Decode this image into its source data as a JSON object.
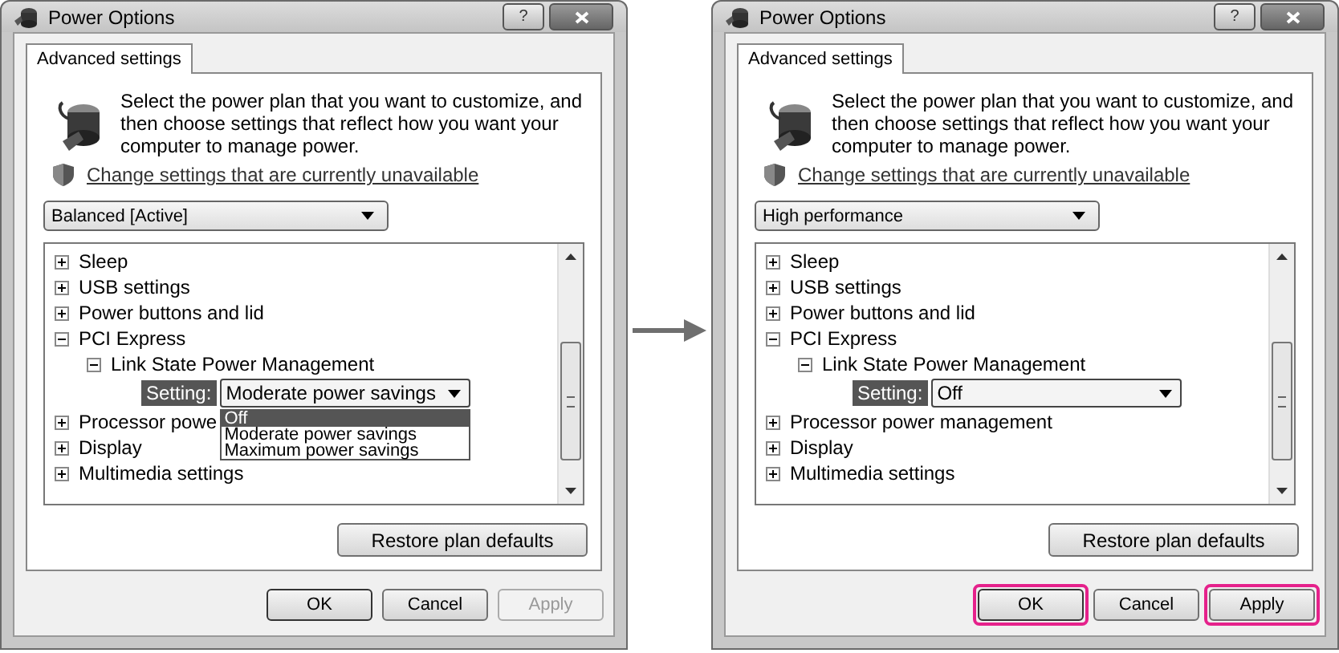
{
  "dialogs": [
    {
      "title": "Power Options",
      "help_button": "?",
      "tab": {
        "label": "Advanced settings",
        "selected": true
      },
      "description": "Select the power plan that you want to customize, and then choose settings that reflect how you want your computer to manage power.",
      "link": "Change settings that are currently unavailable",
      "plan": "Balanced [Active]",
      "tree": [
        {
          "label": "Sleep",
          "expanded": false
        },
        {
          "label": "USB settings",
          "expanded": false
        },
        {
          "label": "Power buttons and lid",
          "expanded": false
        },
        {
          "label": "PCI Express",
          "expanded": true,
          "children": [
            {
              "label": "Link State Power Management",
              "expanded": true,
              "setting": {
                "label": "Setting:",
                "value": "Moderate power savings",
                "open": true,
                "options": [
                  {
                    "label": "Off",
                    "highlighted": true
                  },
                  {
                    "label": "Moderate power savings",
                    "highlighted": false
                  },
                  {
                    "label": "Maximum power savings",
                    "highlighted": false
                  }
                ]
              }
            }
          ]
        },
        {
          "label": "Processor powe",
          "expanded": false
        },
        {
          "label": "Display",
          "expanded": false
        },
        {
          "label": "Multimedia settings",
          "expanded": false
        }
      ],
      "restore_button": "Restore plan defaults",
      "buttons": [
        {
          "label": "OK",
          "disabled": false,
          "highlighted": false
        },
        {
          "label": "Cancel",
          "disabled": false,
          "highlighted": false
        },
        {
          "label": "Apply",
          "disabled": true,
          "highlighted": false
        }
      ]
    },
    {
      "title": "Power Options",
      "help_button": "?",
      "tab": {
        "label": "Advanced settings",
        "selected": true
      },
      "description": "Select the power plan that you want to customize, and then choose settings that reflect how you want your computer to manage power.",
      "link": "Change settings that are currently unavailable",
      "plan": "High performance",
      "tree": [
        {
          "label": "Sleep",
          "expanded": false
        },
        {
          "label": "USB settings",
          "expanded": false
        },
        {
          "label": "Power buttons and lid",
          "expanded": false
        },
        {
          "label": "PCI Express",
          "expanded": true,
          "children": [
            {
              "label": "Link State Power Management",
              "expanded": true,
              "setting": {
                "label": "Setting:",
                "value": "Off",
                "open": false
              }
            }
          ]
        },
        {
          "label": "Processor power management",
          "expanded": false
        },
        {
          "label": "Display",
          "expanded": false
        },
        {
          "label": "Multimedia settings",
          "expanded": false
        }
      ],
      "restore_button": "Restore plan defaults",
      "buttons": [
        {
          "label": "OK",
          "disabled": false,
          "highlighted": true
        },
        {
          "label": "Cancel",
          "disabled": false,
          "highlighted": false
        },
        {
          "label": "Apply",
          "disabled": false,
          "highlighted": true
        }
      ]
    }
  ]
}
